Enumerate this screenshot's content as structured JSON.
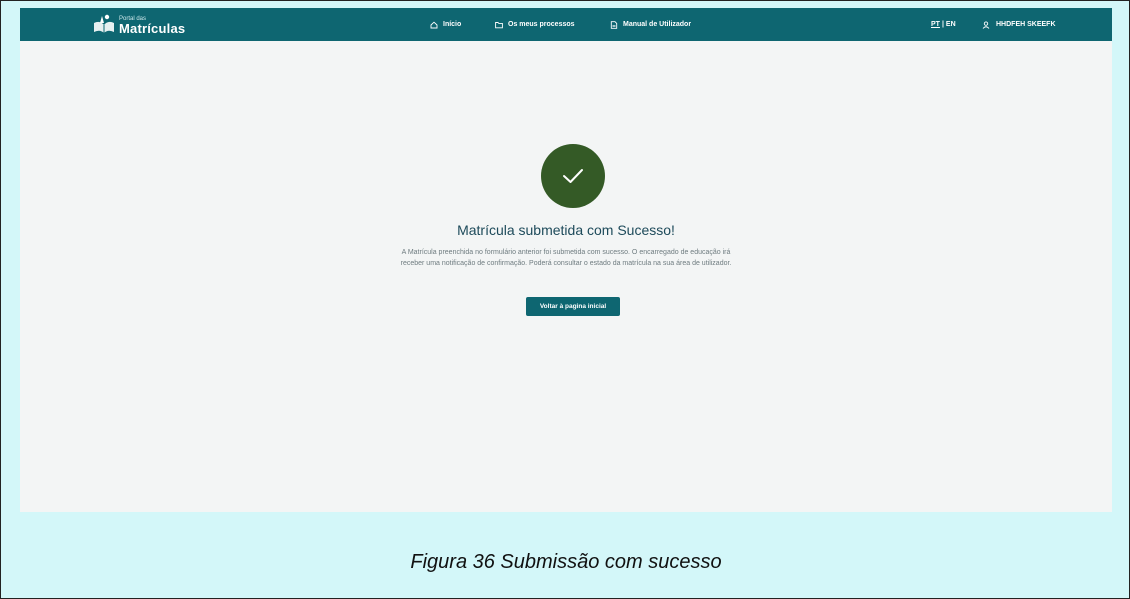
{
  "header": {
    "logo_small": "Portal das",
    "logo_big": "Matrículas",
    "nav": {
      "inicio": "Início",
      "processos": "Os meus processos",
      "manual": "Manual de Utilizador"
    },
    "lang_pt": "PT",
    "lang_sep": "|",
    "lang_en": "EN",
    "user": "HHDFEH SKEEFK"
  },
  "main": {
    "title": "Matrícula submetida com Sucesso!",
    "message": "A Matrícula preenchida no formulário anterior foi submetida com sucesso. O encarregado de educação irá receber uma notificação de confirmação. Poderá consultar o estado da matrícula na sua área de utilizador.",
    "button": "Voltar à pagina inicial"
  },
  "caption": "Figura 36 Submissão com sucesso",
  "colors": {
    "header": "#0e6671",
    "success": "#345a26",
    "caption_bg": "#d3f7f9"
  },
  "icons": [
    "home-icon",
    "folder-icon",
    "document-icon",
    "user-icon",
    "check-icon",
    "logo-icon"
  ]
}
